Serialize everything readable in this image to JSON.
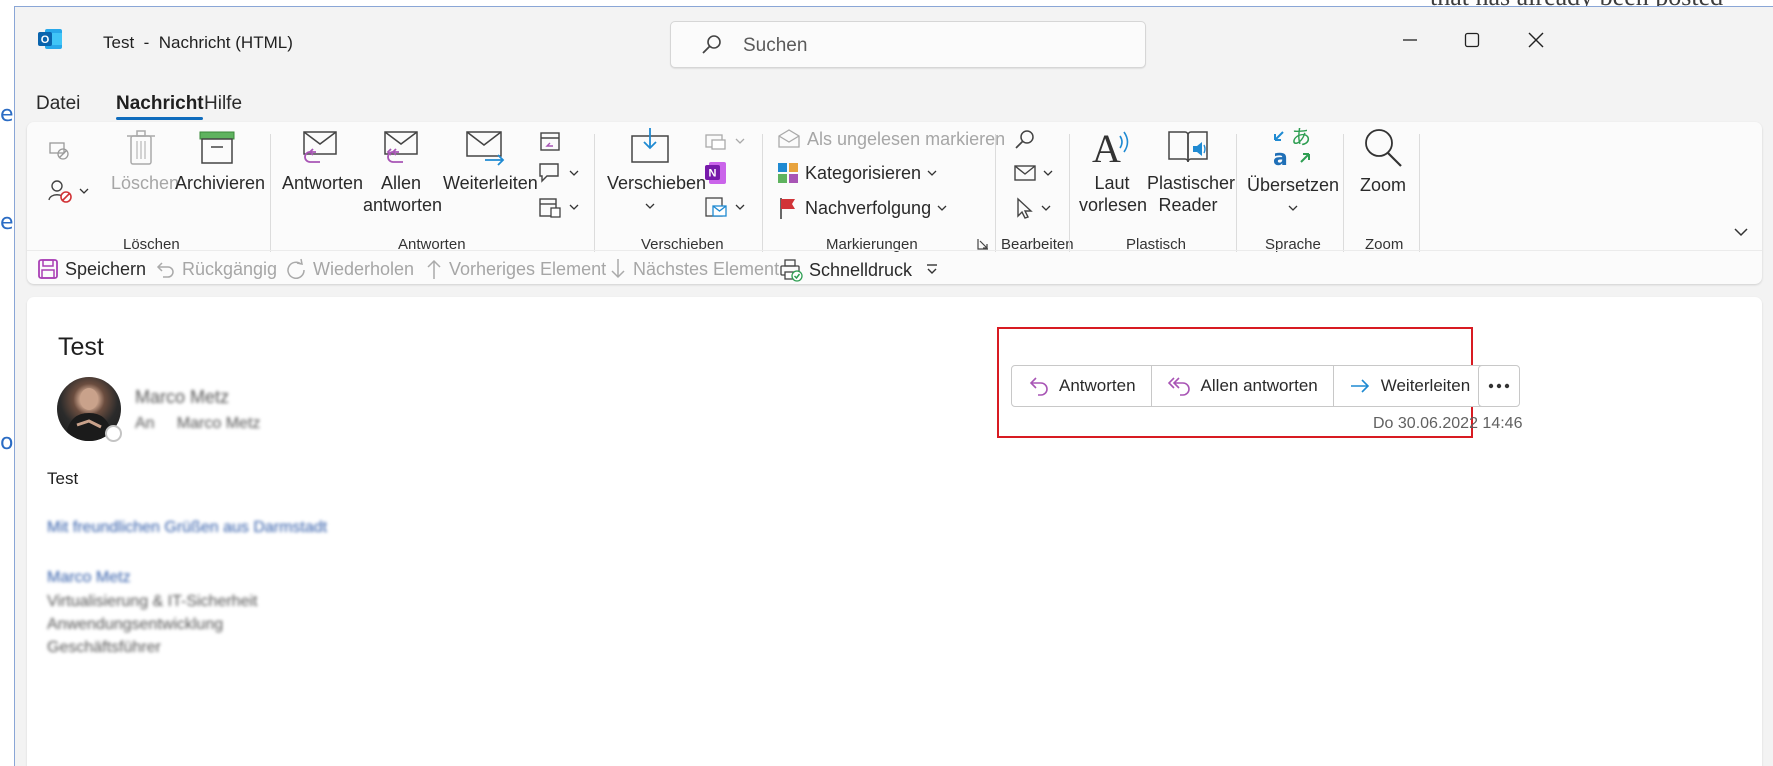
{
  "window": {
    "title": "Test  -  Nachricht (HTML)",
    "search_placeholder": "Suchen"
  },
  "background": {
    "top_text": "that has already been posted"
  },
  "menu": {
    "items": [
      "Datei",
      "Nachricht",
      "Hilfe"
    ],
    "active": "Nachricht"
  },
  "ribbon": {
    "groups": {
      "loeschen": {
        "label": "Löschen",
        "delete": "Löschen",
        "archive": "Archivieren"
      },
      "antworten": {
        "label": "Antworten",
        "reply": "Antworten",
        "reply_all_1": "Allen",
        "reply_all_2": "antworten",
        "forward": "Weiterleiten"
      },
      "verschieben": {
        "label": "Verschieben",
        "move": "Verschieben"
      },
      "markierungen": {
        "label": "Markierungen",
        "unread": "Als ungelesen markieren",
        "categorize": "Kategorisieren",
        "followup": "Nachverfolgung"
      },
      "bearbeiten": {
        "label": "Bearbeiten"
      },
      "plastisch": {
        "label": "Plastisch",
        "read_aloud_1": "Laut",
        "read_aloud_2": "vorlesen",
        "reader_1": "Plastischer",
        "reader_2": "Reader"
      },
      "sprache": {
        "label": "Sprache",
        "translate": "Übersetzen"
      },
      "zoom": {
        "label": "Zoom",
        "zoom": "Zoom"
      }
    }
  },
  "quick_access": {
    "save": "Speichern",
    "undo": "Rückgängig",
    "redo": "Wiederholen",
    "prev": "Vorheriges Element",
    "next": "Nächstes Element",
    "quickprint": "Schnelldruck"
  },
  "message": {
    "subject": "Test",
    "sender_name": "Marco Metz",
    "to_label": "An",
    "recipient": "Marco Metz",
    "date": "Do 30.06.2022 14:46",
    "actions": {
      "reply": "Antworten",
      "reply_all": "Allen antworten",
      "forward": "Weiterleiten"
    },
    "body_first_line": "Test",
    "signature_greeting": "Mit freundlichen Grüßen aus Darmstadt",
    "signature_lines": [
      "Marco Metz",
      "Virtualisierung & IT-Sicherheit",
      "Anwendungsentwicklung",
      "Geschäftsführer"
    ]
  }
}
